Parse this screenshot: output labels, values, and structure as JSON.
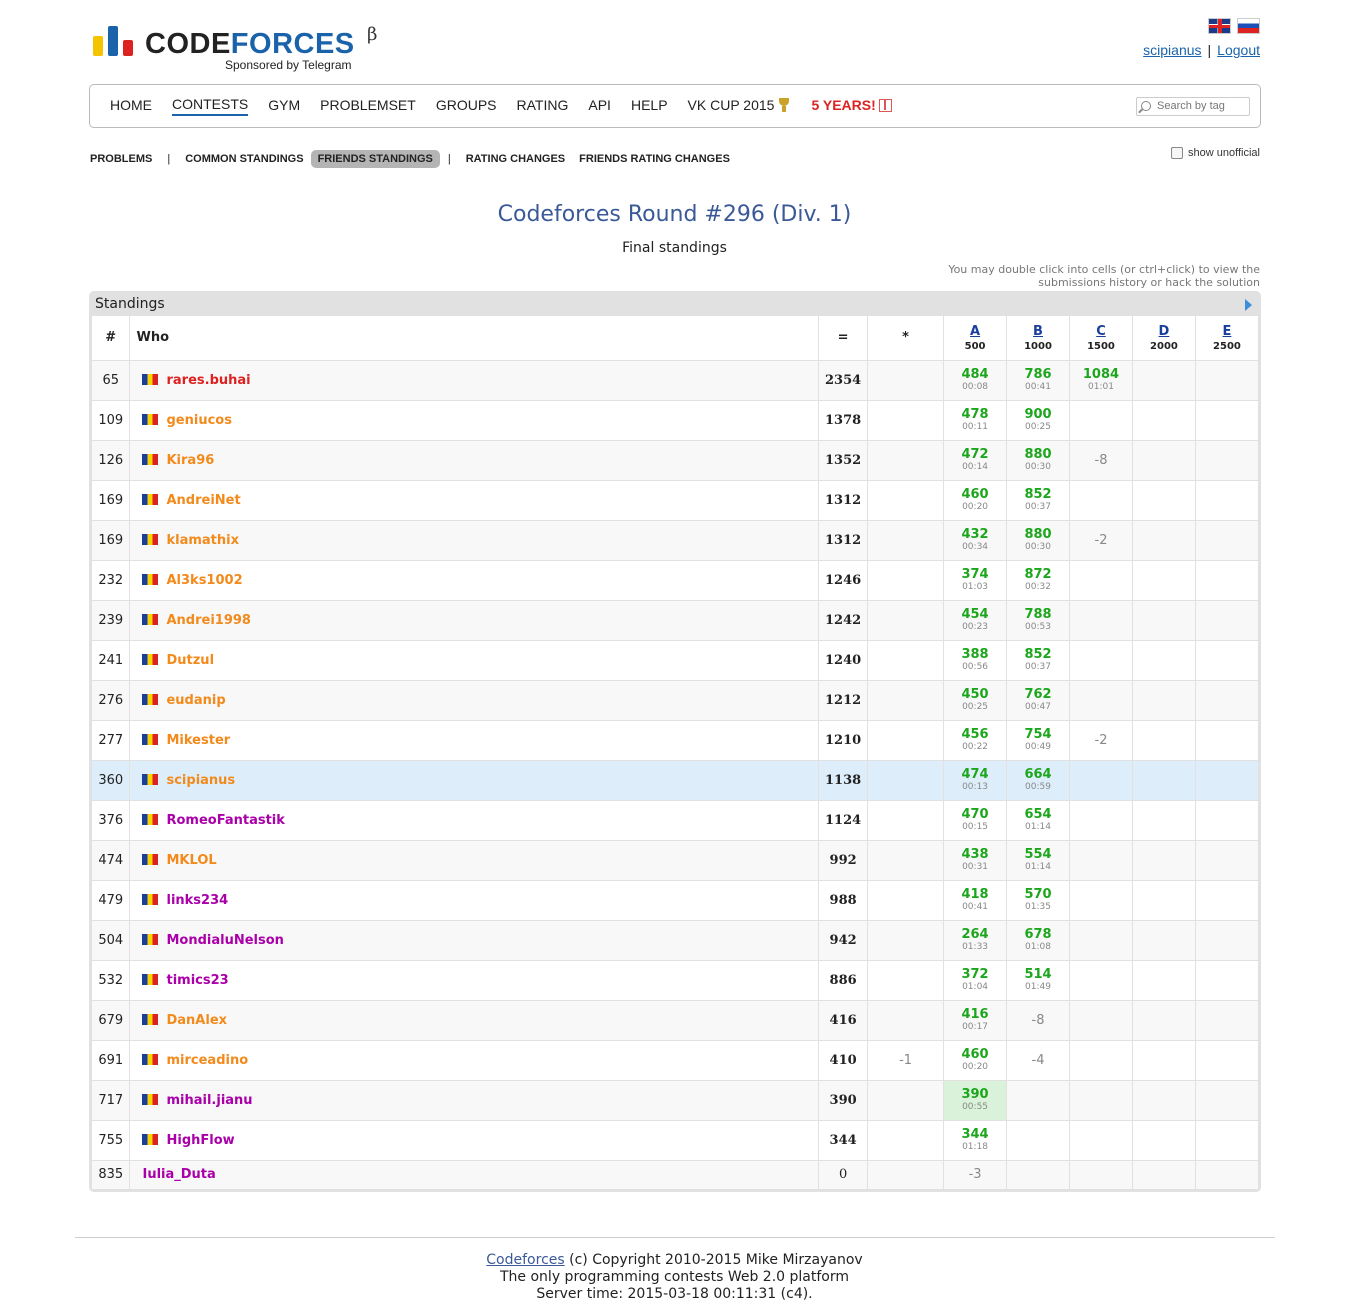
{
  "logo": {
    "brand_black": "CODE",
    "brand_blue": "FORCES",
    "beta": "β",
    "sponsor": "Sponsored by Telegram"
  },
  "user": {
    "name": "scipianus",
    "logout": "Logout",
    "separator": "|"
  },
  "menu": {
    "items": [
      "HOME",
      "CONTESTS",
      "GYM",
      "PROBLEMSET",
      "GROUPS",
      "RATING",
      "API",
      "HELP",
      "VK CUP 2015",
      "5 YEARS!"
    ],
    "search_placeholder": "Search by tag"
  },
  "submenu": {
    "items": [
      "PROBLEMS",
      "COMMON STANDINGS",
      "FRIENDS STANDINGS",
      "RATING CHANGES",
      "FRIENDS RATING CHANGES"
    ],
    "show_unofficial": "show unofficial"
  },
  "contest": {
    "title": "Codeforces Round #296 (Div. 1)",
    "subtitle": "Final standings",
    "hint_line1": "You may double click into cells (or ctrl+click) to view the",
    "hint_line2": "submissions history or hack the solution"
  },
  "standings": {
    "caption": "Standings",
    "headers": {
      "rank": "#",
      "who": "Who",
      "points": "=",
      "hacks": "*"
    },
    "problems": [
      {
        "letter": "A",
        "points": "500"
      },
      {
        "letter": "B",
        "points": "1000"
      },
      {
        "letter": "C",
        "points": "1500"
      },
      {
        "letter": "D",
        "points": "2000"
      },
      {
        "letter": "E",
        "points": "2500"
      }
    ],
    "rows": [
      {
        "rank": "65",
        "handle": "rares.buhai",
        "color": "red",
        "total": "2354",
        "hacks": "",
        "cells": [
          [
            "484",
            "00:08"
          ],
          [
            "786",
            "00:41"
          ],
          [
            "1084",
            "01:01"
          ],
          [
            "",
            ""
          ],
          [
            "",
            ""
          ]
        ]
      },
      {
        "rank": "109",
        "handle": "geniucos",
        "color": "orange",
        "total": "1378",
        "hacks": "",
        "cells": [
          [
            "478",
            "00:11"
          ],
          [
            "900",
            "00:25"
          ],
          [
            "",
            ""
          ],
          [
            "",
            ""
          ],
          [
            "",
            ""
          ]
        ]
      },
      {
        "rank": "126",
        "handle": "Kira96",
        "color": "orange",
        "total": "1352",
        "hacks": "",
        "cells": [
          [
            "472",
            "00:14"
          ],
          [
            "880",
            "00:30"
          ],
          [
            "-8",
            ""
          ],
          [
            "",
            ""
          ],
          [
            "",
            ""
          ]
        ]
      },
      {
        "rank": "169",
        "handle": "AndreiNet",
        "color": "orange",
        "total": "1312",
        "hacks": "",
        "cells": [
          [
            "460",
            "00:20"
          ],
          [
            "852",
            "00:37"
          ],
          [
            "",
            ""
          ],
          [
            "",
            ""
          ],
          [
            "",
            ""
          ]
        ]
      },
      {
        "rank": "169",
        "handle": "klamathix",
        "color": "orange",
        "total": "1312",
        "hacks": "",
        "cells": [
          [
            "432",
            "00:34"
          ],
          [
            "880",
            "00:30"
          ],
          [
            "-2",
            ""
          ],
          [
            "",
            ""
          ],
          [
            "",
            ""
          ]
        ]
      },
      {
        "rank": "232",
        "handle": "Al3ks1002",
        "color": "orange",
        "total": "1246",
        "hacks": "",
        "cells": [
          [
            "374",
            "01:03"
          ],
          [
            "872",
            "00:32"
          ],
          [
            "",
            ""
          ],
          [
            "",
            ""
          ],
          [
            "",
            ""
          ]
        ]
      },
      {
        "rank": "239",
        "handle": "Andrei1998",
        "color": "orange",
        "total": "1242",
        "hacks": "",
        "cells": [
          [
            "454",
            "00:23"
          ],
          [
            "788",
            "00:53"
          ],
          [
            "",
            ""
          ],
          [
            "",
            ""
          ],
          [
            "",
            ""
          ]
        ]
      },
      {
        "rank": "241",
        "handle": "Dutzul",
        "color": "orange",
        "total": "1240",
        "hacks": "",
        "cells": [
          [
            "388",
            "00:56"
          ],
          [
            "852",
            "00:37"
          ],
          [
            "",
            ""
          ],
          [
            "",
            ""
          ],
          [
            "",
            ""
          ]
        ]
      },
      {
        "rank": "276",
        "handle": "eudanip",
        "color": "orange",
        "total": "1212",
        "hacks": "",
        "cells": [
          [
            "450",
            "00:25"
          ],
          [
            "762",
            "00:47"
          ],
          [
            "",
            ""
          ],
          [
            "",
            ""
          ],
          [
            "",
            ""
          ]
        ]
      },
      {
        "rank": "277",
        "handle": "Mikester",
        "color": "orange",
        "total": "1210",
        "hacks": "",
        "cells": [
          [
            "456",
            "00:22"
          ],
          [
            "754",
            "00:49"
          ],
          [
            "-2",
            ""
          ],
          [
            "",
            ""
          ],
          [
            "",
            ""
          ]
        ]
      },
      {
        "rank": "360",
        "handle": "scipianus",
        "color": "orange",
        "total": "1138",
        "hacks": "",
        "cells": [
          [
            "474",
            "00:13"
          ],
          [
            "664",
            "00:59"
          ],
          [
            "",
            ""
          ],
          [
            "",
            ""
          ],
          [
            "",
            ""
          ]
        ]
      },
      {
        "rank": "376",
        "handle": "RomeoFantastik",
        "color": "violet",
        "total": "1124",
        "hacks": "",
        "cells": [
          [
            "470",
            "00:15"
          ],
          [
            "654",
            "01:14"
          ],
          [
            "",
            ""
          ],
          [
            "",
            ""
          ],
          [
            "",
            ""
          ]
        ]
      },
      {
        "rank": "474",
        "handle": "MKLOL",
        "color": "orange",
        "total": "992",
        "hacks": "",
        "cells": [
          [
            "438",
            "00:31"
          ],
          [
            "554",
            "01:14"
          ],
          [
            "",
            ""
          ],
          [
            "",
            ""
          ],
          [
            "",
            ""
          ]
        ]
      },
      {
        "rank": "479",
        "handle": "links234",
        "color": "violet",
        "total": "988",
        "hacks": "",
        "cells": [
          [
            "418",
            "00:41"
          ],
          [
            "570",
            "01:35"
          ],
          [
            "",
            ""
          ],
          [
            "",
            ""
          ],
          [
            "",
            ""
          ]
        ]
      },
      {
        "rank": "504",
        "handle": "MondialuNelson",
        "color": "violet",
        "total": "942",
        "hacks": "",
        "cells": [
          [
            "264",
            "01:33"
          ],
          [
            "678",
            "01:08"
          ],
          [
            "",
            ""
          ],
          [
            "",
            ""
          ],
          [
            "",
            ""
          ]
        ]
      },
      {
        "rank": "532",
        "handle": "timics23",
        "color": "violet",
        "total": "886",
        "hacks": "",
        "cells": [
          [
            "372",
            "01:04"
          ],
          [
            "514",
            "01:49"
          ],
          [
            "",
            ""
          ],
          [
            "",
            ""
          ],
          [
            "",
            ""
          ]
        ]
      },
      {
        "rank": "679",
        "handle": "DanAlex",
        "color": "orange",
        "total": "416",
        "hacks": "",
        "cells": [
          [
            "416",
            "00:17"
          ],
          [
            "-8",
            ""
          ],
          [
            "",
            ""
          ],
          [
            "",
            ""
          ],
          [
            "",
            ""
          ]
        ]
      },
      {
        "rank": "691",
        "handle": "mirceadino",
        "color": "orange",
        "total": "410",
        "hacks": "-1",
        "cells": [
          [
            "460",
            "00:20"
          ],
          [
            "-4",
            ""
          ],
          [
            "",
            ""
          ],
          [
            "",
            ""
          ],
          [
            "",
            ""
          ]
        ]
      },
      {
        "rank": "717",
        "handle": "mihail.jianu",
        "color": "violet",
        "total": "390",
        "hacks": "",
        "cells": [
          [
            "390",
            "00:55"
          ],
          [
            "",
            ""
          ],
          [
            "",
            ""
          ],
          [
            "",
            ""
          ],
          [
            "",
            ""
          ]
        ]
      },
      {
        "rank": "755",
        "handle": "HighFlow",
        "color": "violet",
        "total": "344",
        "hacks": "",
        "cells": [
          [
            "344",
            "01:18"
          ],
          [
            "",
            ""
          ],
          [
            "",
            ""
          ],
          [
            "",
            ""
          ],
          [
            "",
            ""
          ]
        ]
      },
      {
        "rank": "835",
        "handle": "Iulia_Duta",
        "color": "violet",
        "total": "0",
        "hacks": "",
        "cells": [
          [
            "-3",
            ""
          ],
          [
            "",
            ""
          ],
          [
            "",
            ""
          ],
          [
            "",
            ""
          ],
          [
            "",
            ""
          ]
        ]
      }
    ]
  },
  "footer": {
    "link": "Codeforces",
    "copyright": " (c) Copyright 2010-2015 Mike Mirzayanov",
    "line2": "The only programming contests Web 2.0 platform",
    "line3": "Server time: 2015-03-18 00:11:31 (c4)."
  }
}
